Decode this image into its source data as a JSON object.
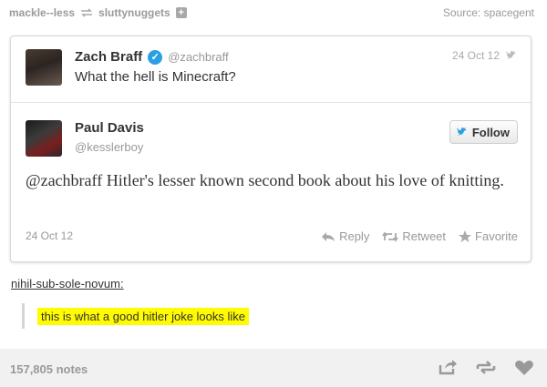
{
  "header": {
    "reblogger": "mackle--less",
    "original_poster": "sluttynuggets",
    "source_label": "Source:",
    "source_user": "spacegent"
  },
  "quoted_tweet": {
    "name": "Zach Braff",
    "handle": "@zachbraff",
    "text": "What the hell is Minecraft?",
    "date": "24 Oct 12"
  },
  "main_tweet": {
    "name": "Paul Davis",
    "handle": "@kesslerboy",
    "follow_label": "Follow",
    "text": "@zachbraff Hitler's lesser known second book about his love of knitting.",
    "date": "24 Oct 12",
    "reply_label": "Reply",
    "retweet_label": "Retweet",
    "favorite_label": "Favorite"
  },
  "comment": {
    "user": "nihil-sub-sole-novum",
    "suffix": ":",
    "text": "this is what a good hitler joke looks like"
  },
  "footer": {
    "notes": "157,805 notes"
  },
  "colors": {
    "verified": "#2b9fe3",
    "highlight": "#fffb00",
    "footer_bg": "#f1f1f1"
  }
}
